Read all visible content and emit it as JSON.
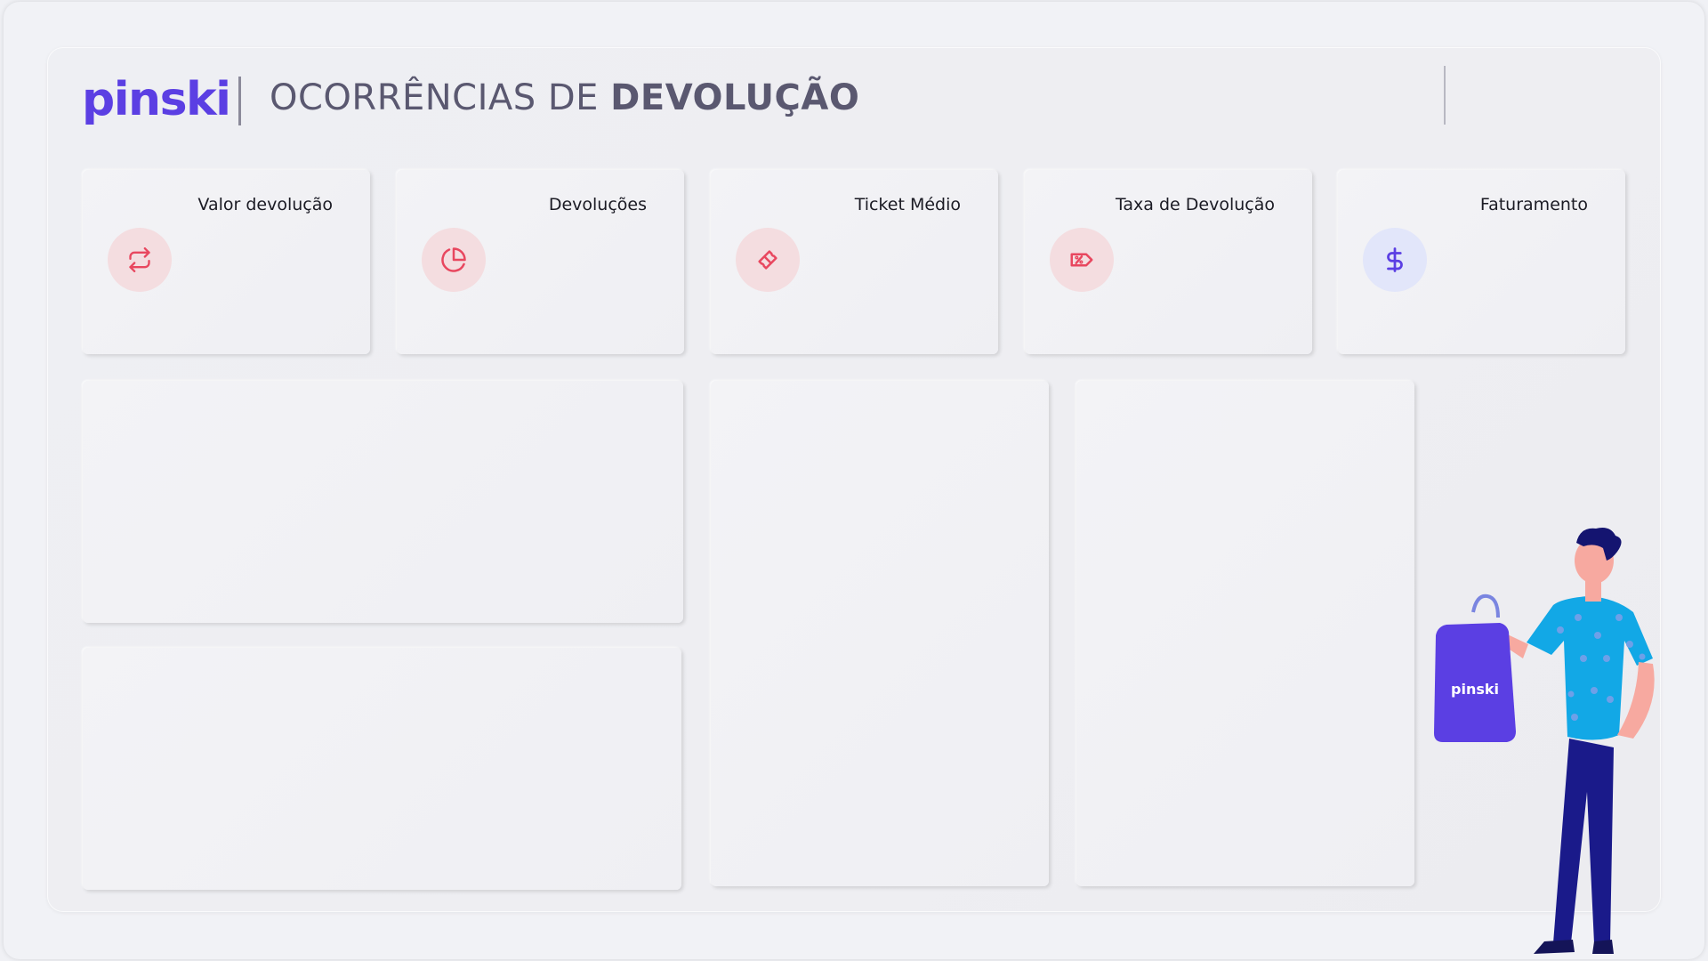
{
  "header": {
    "brand": "pinski",
    "title_light": "OCORRÊNCIAS DE ",
    "title_bold": "DEVOLUÇÃO"
  },
  "kpis": [
    {
      "label": "Valor devolução",
      "icon": "repeat-icon"
    },
    {
      "label": "Devoluções",
      "icon": "pie-chart-icon"
    },
    {
      "label": "Ticket Médio",
      "icon": "ticket-icon"
    },
    {
      "label": "Taxa de Devolução",
      "icon": "discount-tag-icon"
    },
    {
      "label": "Faturamento",
      "icon": "dollar-icon"
    }
  ],
  "illustration": {
    "bag_text": "pinski"
  },
  "colors": {
    "brand": "#5b3fe3",
    "icon_red": "#e8475f",
    "icon_red_bg": "#f4dde0",
    "icon_blue": "#5b3fe3",
    "icon_blue_bg": "#e2e6fa"
  }
}
